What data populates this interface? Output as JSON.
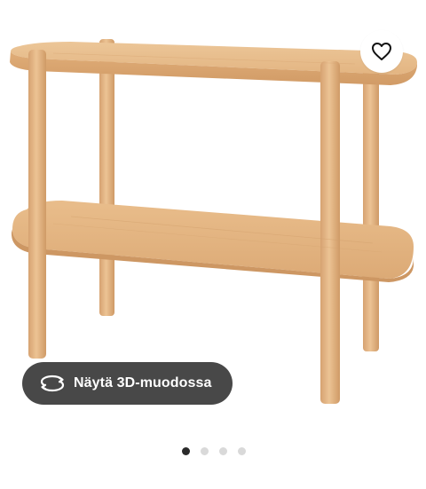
{
  "product_image": {
    "alt": "LISTERBY sivupöytä",
    "wood_light": "#e8be8c",
    "wood_mid": "#d9a773",
    "wood_dark": "#c58f5c"
  },
  "favorite": {
    "icon": "heart-icon"
  },
  "view3d": {
    "label": "Näytä 3D-muodossa",
    "icon": "rotate-360-icon",
    "bg": "#484848"
  },
  "carousel": {
    "count": 4,
    "active_index": 0
  }
}
